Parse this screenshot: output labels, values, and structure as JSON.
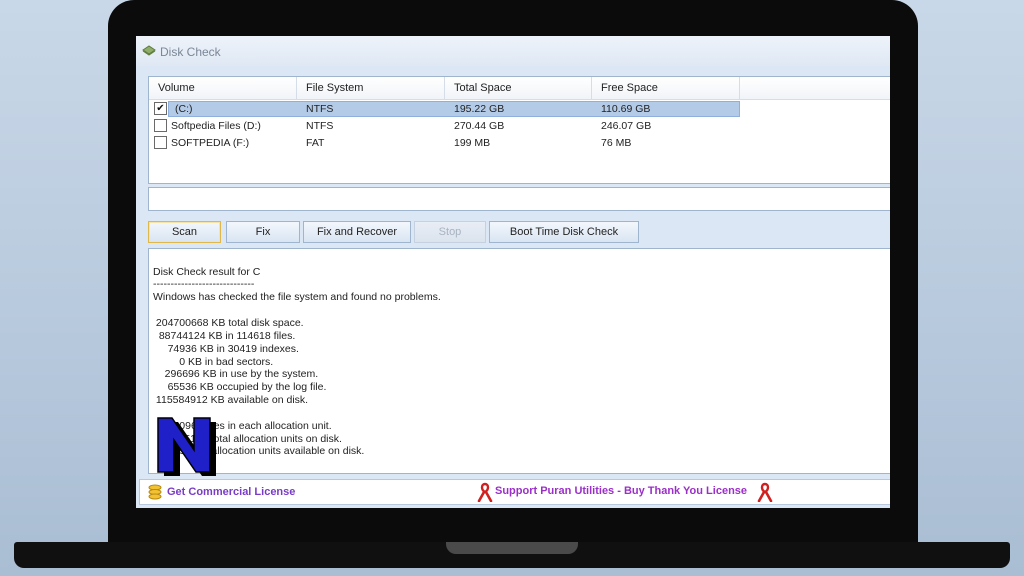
{
  "window": {
    "title": "Disk Check"
  },
  "volumes": {
    "headers": [
      "Volume",
      "File System",
      "Total Space",
      "Free Space"
    ],
    "rows": [
      {
        "checked": true,
        "volume": "(C:)",
        "fs": "NTFS",
        "total": "195.22 GB",
        "free": "110.69 GB",
        "selected": true
      },
      {
        "checked": false,
        "volume": "Softpedia Files (D:)",
        "fs": "NTFS",
        "total": "270.44 GB",
        "free": "246.07 GB",
        "selected": false
      },
      {
        "checked": false,
        "volume": "SOFTPEDIA (F:)",
        "fs": "FAT",
        "total": "199 MB",
        "free": "76 MB",
        "selected": false
      }
    ]
  },
  "path_input": {
    "value": ""
  },
  "buttons": {
    "scan": "Scan",
    "fix": "Fix",
    "fix_recover": "Fix and Recover",
    "stop": "Stop",
    "boot_time": "Boot Time Disk Check"
  },
  "result": {
    "lines": [
      "Disk Check result for C",
      "-----------------------------",
      "Windows has checked the file system and found no problems.",
      "",
      " 204700668 KB total disk space.",
      "  88744124 KB in 114618 files.",
      "     74936 KB in 30419 indexes.",
      "         0 KB in bad sectors.",
      "    296696 KB in use by the system.",
      "     65536 KB occupied by the log file.",
      " 115584912 KB available on disk.",
      "",
      "       4096 bytes in each allocation unit.",
      "   51175167 total allocation units on disk.",
      "   28896228 allocation units available on disk."
    ]
  },
  "status": {
    "license_link": "Get Commercial License",
    "support_link": "Support Puran Utilities - Buy Thank You License"
  },
  "colors": {
    "panel": "#dbe7f5",
    "selection": "#b4cbe8",
    "link_purple": "#7a3cc4",
    "ribbon_red": "#d02020",
    "watermark_blue": "#2020c8"
  }
}
